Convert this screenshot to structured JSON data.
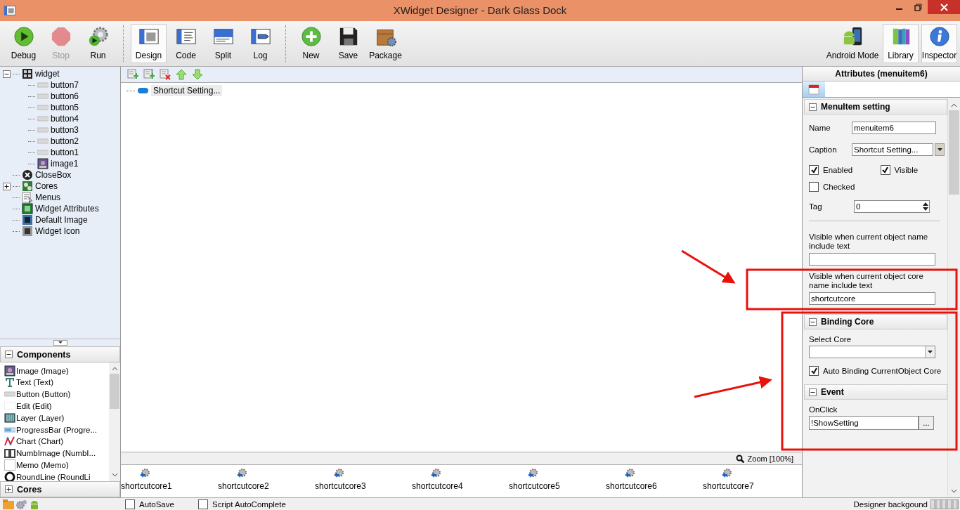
{
  "window": {
    "title": "XWidget Designer - Dark Glass Dock"
  },
  "toolbar": {
    "groups": [
      [
        {
          "label": "Debug",
          "kind": "debug",
          "selected": false,
          "disabled": false
        },
        {
          "label": "Stop",
          "kind": "stop",
          "selected": false,
          "disabled": true
        },
        {
          "label": "Run",
          "kind": "run",
          "selected": false,
          "disabled": false
        }
      ],
      [
        {
          "label": "Design",
          "kind": "design",
          "selected": true,
          "disabled": false
        },
        {
          "label": "Code",
          "kind": "code",
          "selected": false,
          "disabled": false
        },
        {
          "label": "Split",
          "kind": "split",
          "selected": false,
          "disabled": false
        },
        {
          "label": "Log",
          "kind": "log",
          "selected": false,
          "disabled": false
        }
      ],
      [
        {
          "label": "New",
          "kind": "new",
          "selected": false,
          "disabled": false
        },
        {
          "label": "Save",
          "kind": "save",
          "selected": false,
          "disabled": false
        },
        {
          "label": "Package",
          "kind": "package",
          "selected": false,
          "disabled": false
        }
      ]
    ],
    "right": [
      {
        "label": "Android Mode",
        "kind": "android",
        "selected": false
      },
      {
        "label": "Library",
        "kind": "library",
        "selected": true
      },
      {
        "label": "Inspector",
        "kind": "inspector",
        "selected": true
      }
    ]
  },
  "tree": [
    {
      "label": "widget",
      "kind": "widget",
      "expanded": true,
      "children": [
        {
          "label": "button7",
          "kind": "button"
        },
        {
          "label": "button6",
          "kind": "button"
        },
        {
          "label": "button5",
          "kind": "button"
        },
        {
          "label": "button4",
          "kind": "button"
        },
        {
          "label": "button3",
          "kind": "button"
        },
        {
          "label": "button2",
          "kind": "button"
        },
        {
          "label": "button1",
          "kind": "button"
        },
        {
          "label": "image1",
          "kind": "image"
        }
      ]
    },
    {
      "label": "CloseBox",
      "kind": "closebox"
    },
    {
      "label": "Cores",
      "kind": "cores",
      "expanded": false
    },
    {
      "label": "Menus",
      "kind": "menus"
    },
    {
      "label": "Widget Attributes",
      "kind": "attributes"
    },
    {
      "label": "Default Image",
      "kind": "defaultimage"
    },
    {
      "label": "Widget Icon",
      "kind": "icon"
    }
  ],
  "components": {
    "title": "Components",
    "expanded": true,
    "items": [
      {
        "label": "Image (Image)",
        "kind": "image"
      },
      {
        "label": "Text (Text)",
        "kind": "text"
      },
      {
        "label": "Button (Button)",
        "kind": "button"
      },
      {
        "label": "Edit (Edit)",
        "kind": "edit"
      },
      {
        "label": "Layer (Layer)",
        "kind": "layer"
      },
      {
        "label": "ProgressBar (Progre...",
        "kind": "progressbar"
      },
      {
        "label": "Chart (Chart)",
        "kind": "chart"
      },
      {
        "label": "NumbImage (NumbI...",
        "kind": "numbimage"
      },
      {
        "label": "Memo (Memo)",
        "kind": "memo"
      },
      {
        "label": "RoundLine (RoundLi",
        "kind": "roundline"
      }
    ]
  },
  "cores_panel": {
    "title": "Cores",
    "expanded": false
  },
  "designer": {
    "menu_items": [
      {
        "label": "Shortcut Setting...",
        "selected": true
      }
    ],
    "zoom": "Zoom [100%]",
    "cores": [
      "shortcutcore1",
      "shortcutcore2",
      "shortcutcore3",
      "shortcutcore4",
      "shortcutcore5",
      "shortcutcore6",
      "shortcutcore7"
    ]
  },
  "inspector": {
    "title": "Attributes (menuitem6)",
    "tabs": [
      {
        "kind": "calendar",
        "selected": true
      }
    ],
    "sections": [
      {
        "title": "MenuItem setting",
        "expanded": true,
        "fields": [
          {
            "kind": "text",
            "label": "Name",
            "value": "menuitem6"
          },
          {
            "kind": "combo",
            "label": "Caption",
            "value": "Shortcut Setting..."
          },
          {
            "kind": "checkpair",
            "items": [
              {
                "label": "Enabled",
                "checked": true
              },
              {
                "label": "Visible",
                "checked": true
              }
            ]
          },
          {
            "kind": "check",
            "label": "Checked",
            "checked": false
          },
          {
            "kind": "spin",
            "label": "Tag",
            "value": "0"
          },
          {
            "kind": "divider"
          },
          {
            "kind": "stacked",
            "label": "Visible when current object name include text"
          },
          {
            "kind": "stacked",
            "label": "Visible when current object core name include text",
            "value": "shortcutcore"
          }
        ]
      },
      {
        "title": "Binding Core",
        "expanded": true,
        "fields": [
          {
            "kind": "stacked-combo",
            "label": "Select Core"
          },
          {
            "kind": "check",
            "label": "Auto Binding CurrentObject Core",
            "checked": true
          }
        ]
      },
      {
        "title": "Event",
        "expanded": true,
        "fields": [
          {
            "kind": "stacked-button",
            "label": "OnClick",
            "value": "!ShowSetting",
            "button": "..."
          }
        ]
      }
    ]
  },
  "status_bar": {
    "checkboxes": [
      {
        "label": "AutoSave",
        "checked": false
      },
      {
        "label": "Script AutoComplete",
        "checked": false
      }
    ],
    "background_label": "Designer backgound"
  }
}
